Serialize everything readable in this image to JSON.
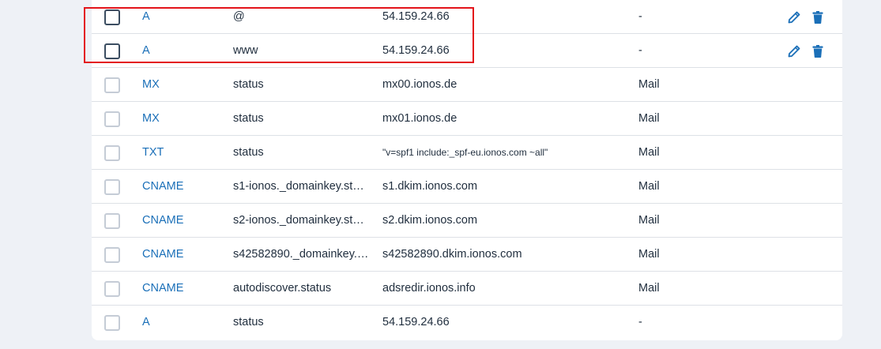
{
  "records": [
    {
      "type": "A",
      "host": "@",
      "value": "54.159.24.66",
      "service": "-",
      "editable": true
    },
    {
      "type": "A",
      "host": "www",
      "value": "54.159.24.66",
      "service": "-",
      "editable": true
    },
    {
      "type": "MX",
      "host": "status",
      "value": "mx00.ionos.de",
      "service": "Mail"
    },
    {
      "type": "MX",
      "host": "status",
      "value": "mx01.ionos.de",
      "service": "Mail"
    },
    {
      "type": "TXT",
      "host": "status",
      "value": "\"v=spf1 include:_spf-eu.ionos.com ~all\"",
      "service": "Mail"
    },
    {
      "type": "CNAME",
      "host": "s1-ionos._domainkey.sta…",
      "value": "s1.dkim.ionos.com",
      "service": "Mail"
    },
    {
      "type": "CNAME",
      "host": "s2-ionos._domainkey.sta…",
      "value": "s2.dkim.ionos.com",
      "service": "Mail"
    },
    {
      "type": "CNAME",
      "host": "s42582890._domainkey.…",
      "value": "s42582890.dkim.ionos.com",
      "service": "Mail"
    },
    {
      "type": "CNAME",
      "host": "autodiscover.status",
      "value": "adsredir.ionos.info",
      "service": "Mail"
    },
    {
      "type": "A",
      "host": "status",
      "value": "54.159.24.66",
      "service": "-"
    }
  ],
  "icons": {
    "edit": "pencil-icon",
    "delete": "trash-icon"
  },
  "colors": {
    "link": "#1a6fb8",
    "highlight": "#e3141a"
  }
}
